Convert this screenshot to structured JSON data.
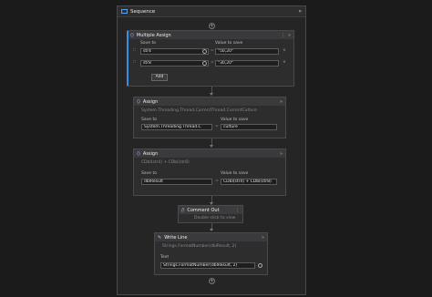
{
  "sequence": {
    "title": "Sequence",
    "collapse_icon": "double-chevron-up"
  },
  "multiple_assign": {
    "title": "Multiple Assign",
    "col_save_to": "Save to",
    "col_value": "Value to save",
    "rows": [
      {
        "save_to": "str4",
        "value": "\"50,20\""
      },
      {
        "save_to": "str8",
        "value": "\"30,20\""
      }
    ],
    "add_label": "Add"
  },
  "assign1": {
    "title": "Assign",
    "summary": "System.Threading.Thread.CurrentThread.CurrentCulture",
    "save_to_label": "Save to",
    "value_label": "Value to save",
    "save_to": "System.Threading.Thread.C",
    "value": "culture"
  },
  "assign2": {
    "title": "Assign",
    "summary": "CDbl(str4) + CDbl(str8)",
    "save_to_label": "Save to",
    "value_label": "Value to save",
    "save_to": "dblResult",
    "value": "CDbl(str4) + CDbl(str8)"
  },
  "comment_out": {
    "title": "Comment Out",
    "hint": "Double-click to view"
  },
  "write_line": {
    "title": "Write Line",
    "summary": "Strings.FormatNumber(dblResult, 2)",
    "text_label": "Text",
    "text_value": "Strings.FormatNumber(dblResult, 2)"
  },
  "glyphs": {
    "plus": "+",
    "eq": "=",
    "collapse": "»",
    "menu": "⋮",
    "remove": "×",
    "drag": "∷"
  }
}
